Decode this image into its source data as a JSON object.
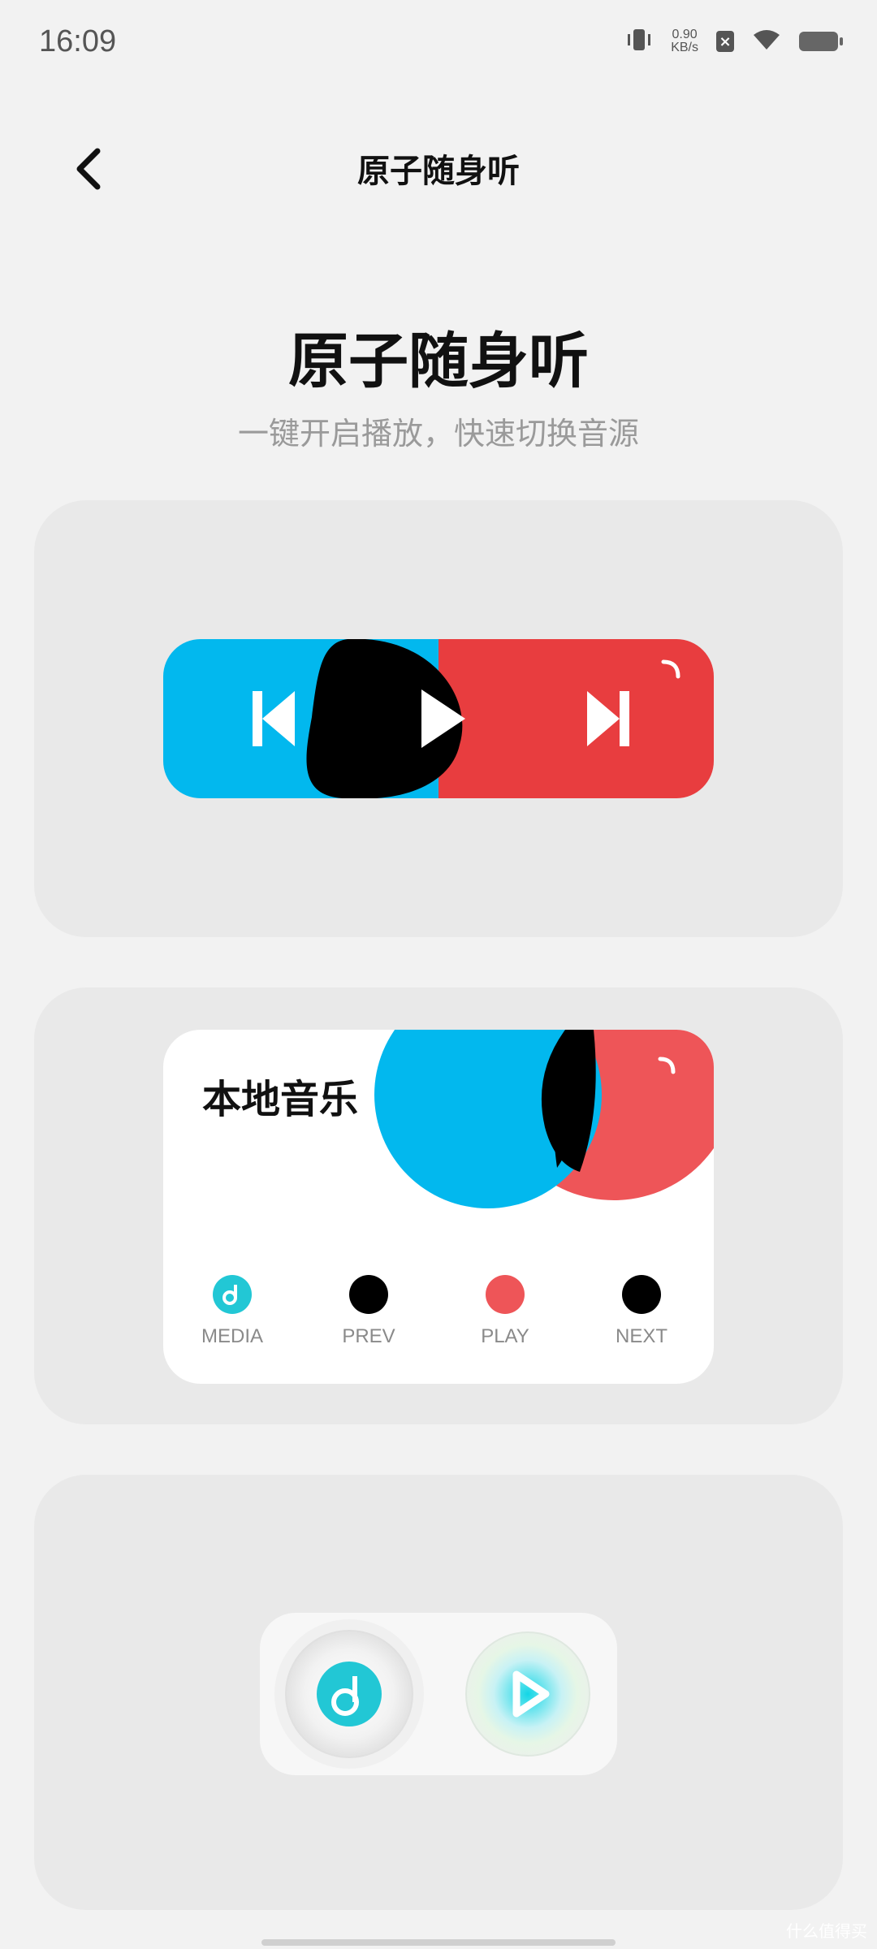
{
  "status_bar": {
    "time": "16:09",
    "net_speed_value": "0.90",
    "net_speed_unit": "KB/s"
  },
  "header": {
    "title": "原子随身听"
  },
  "hero": {
    "title": "原子随身听",
    "subtitle": "一键开启播放，快速切换音源"
  },
  "widget_local": {
    "title": "本地音乐",
    "buttons": [
      {
        "label": "MEDIA"
      },
      {
        "label": "PREV"
      },
      {
        "label": "PLAY"
      },
      {
        "label": "NEXT"
      }
    ]
  },
  "colors": {
    "blue": "#02b8ee",
    "red": "#e83d3f",
    "black": "#000000",
    "teal": "#22c7d5"
  },
  "watermark": "什么值得买"
}
